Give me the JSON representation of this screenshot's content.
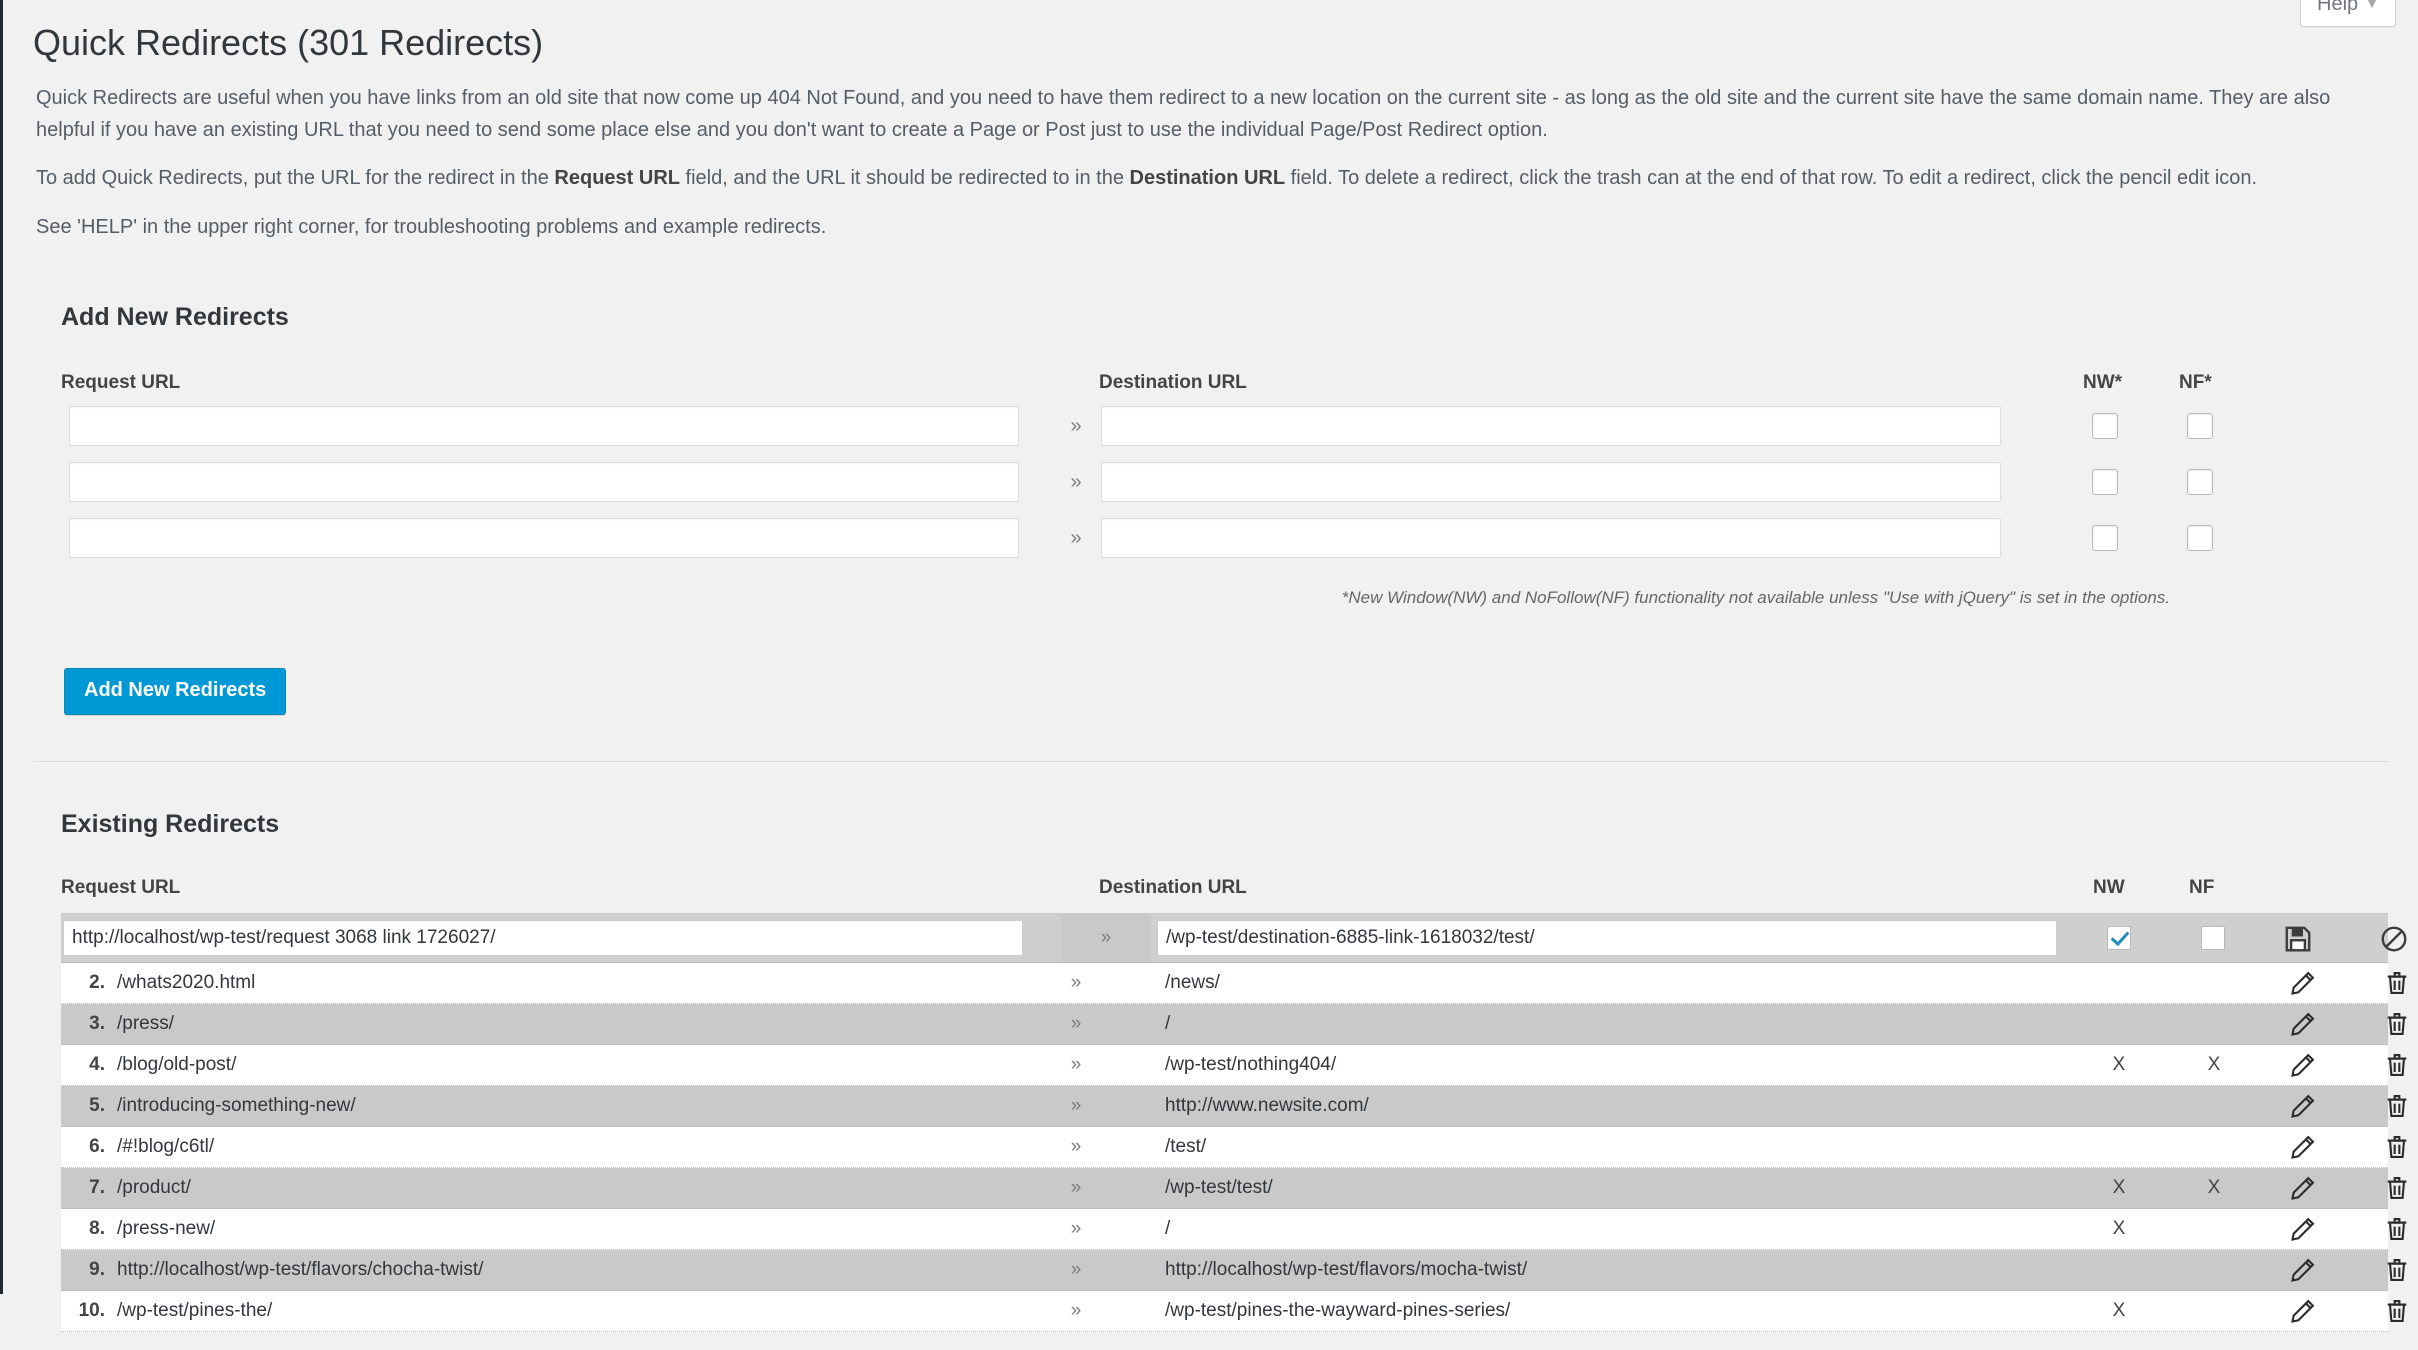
{
  "help": {
    "label": "Help",
    "caret": "▼"
  },
  "page_title": "Quick Redirects (301 Redirects)",
  "intro": {
    "p1_a": "Quick Redirects are useful when you have links from an old site that now come up 404 Not Found, and you need to have them redirect to a new location on the current site - as long as the old site and the current site have the same domain name. They are also helpful if you have an existing URL that you need to send some place else and you don't want to create a Page or Post just to use the individual Page/Post Redirect option.",
    "p2_a": "To add Quick Redirects, put the URL for the redirect in the ",
    "p2_b": "Request URL",
    "p2_c": " field, and the URL it should be redirected to in the ",
    "p2_d": "Destination URL",
    "p2_e": " field. To delete a redirect, click the trash can at the end of that row. To edit a redirect, click the pencil edit icon.",
    "p3": "See 'HELP' in the upper right corner, for troubleshooting problems and example redirects."
  },
  "add_new": {
    "title": "Add New Redirects",
    "col_request": "Request URL",
    "col_destination": "Destination URL",
    "col_nw": "NW*",
    "col_nf": "NF*",
    "arrow": "»",
    "rows": [
      {
        "request": "",
        "destination": "",
        "nw": false,
        "nf": false
      },
      {
        "request": "",
        "destination": "",
        "nw": false,
        "nf": false
      },
      {
        "request": "",
        "destination": "",
        "nw": false,
        "nf": false
      }
    ],
    "footnote": "*New Window(NW) and NoFollow(NF) functionality not available unless \"Use with jQuery\" is set in the options.",
    "submit_label": "Add New Redirects"
  },
  "existing": {
    "title": "Existing Redirects",
    "col_request": "Request URL",
    "col_destination": "Destination URL",
    "col_nw": "NW",
    "col_nf": "NF",
    "arrow": "»",
    "marker": "X",
    "editing_row": {
      "request": "http://localhost/wp-test/request 3068 link 1726027/",
      "destination": "/wp-test/destination-6885-link-1618032/test/",
      "nw": true,
      "nf": false
    },
    "rows": [
      {
        "num": "2.",
        "request": "/whats2020.html",
        "destination": "/news/",
        "nw": "",
        "nf": ""
      },
      {
        "num": "3.",
        "request": "/press/",
        "destination": "/",
        "nw": "",
        "nf": ""
      },
      {
        "num": "4.",
        "request": "/blog/old-post/",
        "destination": "/wp-test/nothing404/",
        "nw": "X",
        "nf": "X"
      },
      {
        "num": "5.",
        "request": "/introducing-something-new/",
        "destination": "http://www.newsite.com/",
        "nw": "",
        "nf": ""
      },
      {
        "num": "6.",
        "request": "/#!blog/c6tl/",
        "destination": "/test/",
        "nw": "",
        "nf": ""
      },
      {
        "num": "7.",
        "request": "/product/",
        "destination": "/wp-test/test/",
        "nw": "X",
        "nf": "X"
      },
      {
        "num": "8.",
        "request": "/press-new/",
        "destination": "/",
        "nw": "X",
        "nf": ""
      },
      {
        "num": "9.",
        "request": "http://localhost/wp-test/flavors/chocha-twist/",
        "destination": "http://localhost/wp-test/flavors/mocha-twist/",
        "nw": "",
        "nf": ""
      },
      {
        "num": "10.",
        "request": "/wp-test/pines-the/",
        "destination": "/wp-test/pines-the-wayward-pines-series/",
        "nw": "X",
        "nf": ""
      }
    ]
  },
  "icons": {
    "edit": "pencil-icon",
    "delete": "trash-icon",
    "save": "floppy-save-icon",
    "cancel": "cancel-circle-icon"
  },
  "colors": {
    "accent_blue": "#0099d5",
    "check_blue": "#1e8cbe",
    "admin_bg": "#f1f1f1",
    "row_alt": "#c9c9c9"
  }
}
